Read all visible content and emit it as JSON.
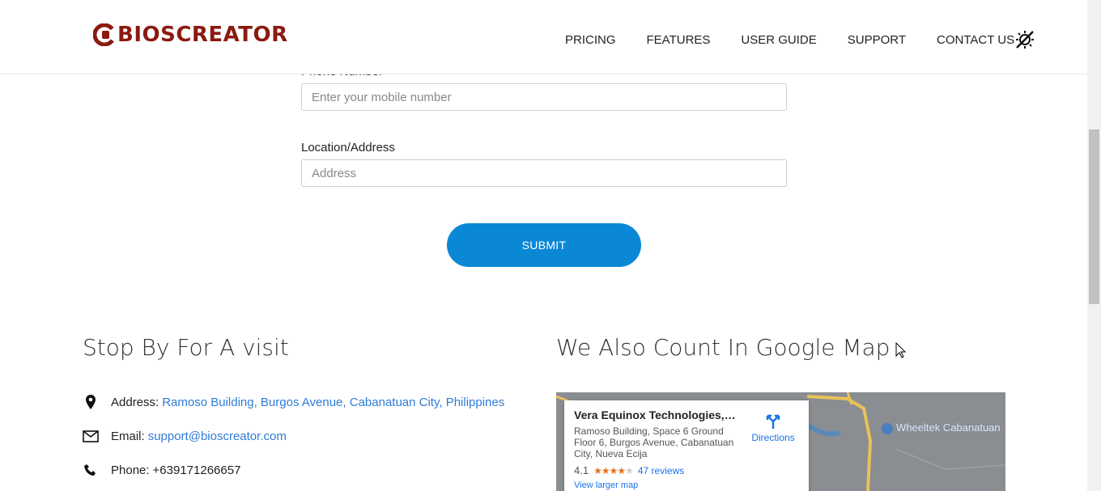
{
  "header": {
    "logo_text": "BIOSCREATOR",
    "brand_color": "#8b1a10",
    "nav": [
      "PRICING",
      "FEATURES",
      "USER GUIDE",
      "SUPPORT",
      "CONTACT US"
    ],
    "theme_toggle_icon": "theme-toggle-icon"
  },
  "form": {
    "phone_label": "Phone Number",
    "phone_placeholder": "Enter your mobile number",
    "location_label": "Location/Address",
    "location_placeholder": "Address",
    "submit_label": "SUBMIT",
    "accent": "#0a88d6"
  },
  "visit": {
    "title": "Stop By For A visit",
    "address_label": "Address:",
    "address_value": "Ramoso Building, Burgos Avenue, Cabanatuan City, Philippines",
    "email_label": "Email:",
    "email_value": "support@bioscreator.com",
    "phone_label": "Phone:",
    "phone_value": "+639171266657"
  },
  "map_section": {
    "title": "We Also Count In Google Map",
    "card_title": "Vera Equinox Technologies, In...",
    "card_address": "Ramoso Building, Space 6 Ground Floor 6, Burgos Avenue, Cabanatuan City, Nueva Ecija",
    "rating": "4.1",
    "stars": 4.1,
    "reviews": "47 reviews",
    "directions": "Directions",
    "larger_map": "View larger map",
    "place_label": "Wheeltek Cabanatuan"
  }
}
